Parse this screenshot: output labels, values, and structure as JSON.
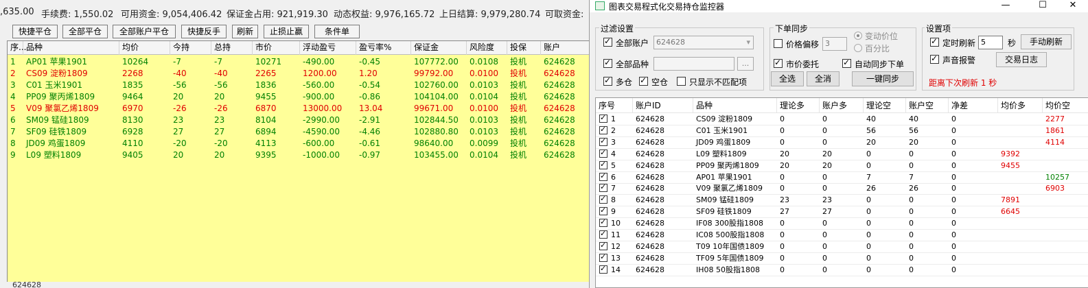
{
  "summary": {
    "balance_tail": ",635.00",
    "fee": "手续费: 1,550.02",
    "available": "可用资金: 9,054,406.42",
    "margin_used": "保证金占用: 921,919.30",
    "dynamic_equity": "动态权益: 9,976,165.72",
    "last_settle": "上日结算: 9,979,280.74",
    "withdrawable": "可取资金:"
  },
  "toolbar": {
    "quick_close": "快捷平仓",
    "close_all": "全部平仓",
    "close_all_accounts": "全部账户平仓",
    "quick_reverse": "快捷反手",
    "refresh": "刷新",
    "stop_loss_profit": "止损止赢",
    "conditional": "条件单"
  },
  "positions": {
    "headers": [
      "序...",
      "品种",
      "均价",
      "今持",
      "总持",
      "市价",
      "浮动盈亏",
      "盈亏率%",
      "保证金",
      "风险度",
      "投保",
      "账户"
    ],
    "rows": [
      {
        "no": "1",
        "symbol": "AP01 苹果1901",
        "avg": "10264",
        "today": "-7",
        "total": "-7",
        "price": "10271",
        "pnl": "-490.00",
        "pnl_pct": "-0.45",
        "margin": "107772.00",
        "risk": "0.0108",
        "hedge": "投机",
        "account": "624628",
        "color": "green"
      },
      {
        "no": "2",
        "symbol": "CS09 淀粉1809",
        "avg": "2268",
        "today": "-40",
        "total": "-40",
        "price": "2265",
        "pnl": "1200.00",
        "pnl_pct": "1.20",
        "margin": "99792.00",
        "risk": "0.0100",
        "hedge": "投机",
        "account": "624628",
        "color": "red"
      },
      {
        "no": "3",
        "symbol": "C01 玉米1901",
        "avg": "1835",
        "today": "-56",
        "total": "-56",
        "price": "1836",
        "pnl": "-560.00",
        "pnl_pct": "-0.54",
        "margin": "102760.00",
        "risk": "0.0103",
        "hedge": "投机",
        "account": "624628",
        "color": "green"
      },
      {
        "no": "4",
        "symbol": "PP09 聚丙烯1809",
        "avg": "9464",
        "today": "20",
        "total": "20",
        "price": "9455",
        "pnl": "-900.00",
        "pnl_pct": "-0.86",
        "margin": "104104.00",
        "risk": "0.0104",
        "hedge": "投机",
        "account": "624628",
        "color": "green"
      },
      {
        "no": "5",
        "symbol": "V09 聚氯乙烯1809",
        "avg": "6970",
        "today": "-26",
        "total": "-26",
        "price": "6870",
        "pnl": "13000.00",
        "pnl_pct": "13.04",
        "margin": "99671.00",
        "risk": "0.0100",
        "hedge": "投机",
        "account": "624628",
        "color": "red"
      },
      {
        "no": "6",
        "symbol": "SM09 锰硅1809",
        "avg": "8130",
        "today": "23",
        "total": "23",
        "price": "8104",
        "pnl": "-2990.00",
        "pnl_pct": "-2.91",
        "margin": "102844.50",
        "risk": "0.0103",
        "hedge": "投机",
        "account": "624628",
        "color": "green"
      },
      {
        "no": "7",
        "symbol": "SF09 硅铁1809",
        "avg": "6928",
        "today": "27",
        "total": "27",
        "price": "6894",
        "pnl": "-4590.00",
        "pnl_pct": "-4.46",
        "margin": "102880.80",
        "risk": "0.0103",
        "hedge": "投机",
        "account": "624628",
        "color": "green"
      },
      {
        "no": "8",
        "symbol": "JD09 鸡蛋1809",
        "avg": "4110",
        "today": "-20",
        "total": "-20",
        "price": "4113",
        "pnl": "-600.00",
        "pnl_pct": "-0.61",
        "margin": "98640.00",
        "risk": "0.0099",
        "hedge": "投机",
        "account": "624628",
        "color": "green"
      },
      {
        "no": "9",
        "symbol": "L09 塑料1809",
        "avg": "9405",
        "today": "20",
        "total": "20",
        "price": "9395",
        "pnl": "-1000.00",
        "pnl_pct": "-0.97",
        "margin": "103455.00",
        "risk": "0.0104",
        "hedge": "投机",
        "account": "624628",
        "color": "green"
      }
    ]
  },
  "left_status": "624628",
  "window": {
    "title": "图表交易程式化交易持仓监控器",
    "minimize": "—",
    "maximize": "☐",
    "close": "✕"
  },
  "filter": {
    "title": "过滤设置",
    "all_accounts": "全部账户",
    "account_value": "624628",
    "all_symbols": "全部品种",
    "symbol_value": "",
    "browse": "...",
    "long": "多仓",
    "short": "空仓",
    "only_mismatch": "只显示不匹配项"
  },
  "order_sync": {
    "title": "下单同步",
    "price_offset": "价格偏移",
    "offset_value": "3",
    "tick_price": "变动价位",
    "percent": "百分比",
    "market_order": "市价委托",
    "auto_sync": "自动同步下单",
    "select_all": "全选",
    "deselect_all": "全消",
    "one_click_sync": "一键同步"
  },
  "settings": {
    "title": "设置项",
    "timed_refresh": "定时刷新",
    "refresh_seconds": "5",
    "seconds_unit": "秒",
    "manual_refresh": "手动刷新",
    "sound_alert": "声音报警",
    "trade_log": "交易日志",
    "countdown": "距离下次刷新 1 秒"
  },
  "monitor": {
    "headers": [
      "序号",
      "账户ID",
      "品种",
      "理论多",
      "账户多",
      "理论空",
      "账户空",
      "净差",
      "均价多",
      "均价空"
    ],
    "rows": [
      {
        "no": "1",
        "account": "624628",
        "symbol": "CS09 淀粉1809",
        "th_long": "0",
        "ac_long": "0",
        "th_short": "40",
        "ac_short": "40",
        "diff": "0",
        "avg_long": "",
        "avg_short": "2277",
        "avg_short_color": "red"
      },
      {
        "no": "2",
        "account": "624628",
        "symbol": "C01 玉米1901",
        "th_long": "0",
        "ac_long": "0",
        "th_short": "56",
        "ac_short": "56",
        "diff": "0",
        "avg_long": "",
        "avg_short": "1861",
        "avg_short_color": "red"
      },
      {
        "no": "3",
        "account": "624628",
        "symbol": "JD09 鸡蛋1809",
        "th_long": "0",
        "ac_long": "0",
        "th_short": "20",
        "ac_short": "20",
        "diff": "0",
        "avg_long": "",
        "avg_short": "4114",
        "avg_short_color": "red"
      },
      {
        "no": "4",
        "account": "624628",
        "symbol": "L09 塑料1809",
        "th_long": "20",
        "ac_long": "20",
        "th_short": "0",
        "ac_short": "0",
        "diff": "0",
        "avg_long": "9392",
        "avg_short": "",
        "avg_short_color": "red"
      },
      {
        "no": "5",
        "account": "624628",
        "symbol": "PP09 聚丙烯1809",
        "th_long": "20",
        "ac_long": "20",
        "th_short": "0",
        "ac_short": "0",
        "diff": "0",
        "avg_long": "9455",
        "avg_short": "",
        "avg_short_color": "red"
      },
      {
        "no": "6",
        "account": "624628",
        "symbol": "AP01 苹果1901",
        "th_long": "0",
        "ac_long": "0",
        "th_short": "7",
        "ac_short": "7",
        "diff": "0",
        "avg_long": "",
        "avg_short": "10257",
        "avg_short_color": "green"
      },
      {
        "no": "7",
        "account": "624628",
        "symbol": "V09 聚氯乙烯1809",
        "th_long": "0",
        "ac_long": "0",
        "th_short": "26",
        "ac_short": "26",
        "diff": "0",
        "avg_long": "",
        "avg_short": "6903",
        "avg_short_color": "red"
      },
      {
        "no": "8",
        "account": "624628",
        "symbol": "SM09 锰硅1809",
        "th_long": "23",
        "ac_long": "23",
        "th_short": "0",
        "ac_short": "0",
        "diff": "0",
        "avg_long": "7891",
        "avg_short": "",
        "avg_short_color": "red"
      },
      {
        "no": "9",
        "account": "624628",
        "symbol": "SF09 硅铁1809",
        "th_long": "27",
        "ac_long": "27",
        "th_short": "0",
        "ac_short": "0",
        "diff": "0",
        "avg_long": "6645",
        "avg_short": "",
        "avg_short_color": "red"
      },
      {
        "no": "10",
        "account": "624628",
        "symbol": "IF08 300股指1808",
        "th_long": "0",
        "ac_long": "0",
        "th_short": "0",
        "ac_short": "0",
        "diff": "0",
        "avg_long": "",
        "avg_short": "",
        "avg_short_color": "red"
      },
      {
        "no": "11",
        "account": "624628",
        "symbol": "IC08 500股指1808",
        "th_long": "0",
        "ac_long": "0",
        "th_short": "0",
        "ac_short": "0",
        "diff": "0",
        "avg_long": "",
        "avg_short": "",
        "avg_short_color": "red"
      },
      {
        "no": "12",
        "account": "624628",
        "symbol": "T09 10年国债1809",
        "th_long": "0",
        "ac_long": "0",
        "th_short": "0",
        "ac_short": "0",
        "diff": "0",
        "avg_long": "",
        "avg_short": "",
        "avg_short_color": "red"
      },
      {
        "no": "13",
        "account": "624628",
        "symbol": "TF09 5年国债1809",
        "th_long": "0",
        "ac_long": "0",
        "th_short": "0",
        "ac_short": "0",
        "diff": "0",
        "avg_long": "",
        "avg_short": "",
        "avg_short_color": "red"
      },
      {
        "no": "14",
        "account": "624628",
        "symbol": "IH08 50股指1808",
        "th_long": "0",
        "ac_long": "0",
        "th_short": "0",
        "ac_short": "0",
        "diff": "0",
        "avg_long": "",
        "avg_short": "",
        "avg_short_color": "red"
      }
    ]
  },
  "colors": {
    "table_bg": "#ffff99",
    "profit": "#e00000",
    "loss": "#008000"
  }
}
